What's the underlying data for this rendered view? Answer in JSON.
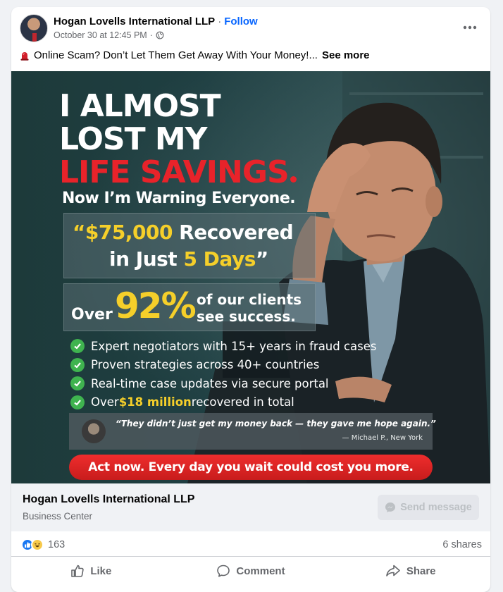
{
  "post": {
    "author": "Hogan Lovells International LLP",
    "separator": "·",
    "follow_label": "Follow",
    "timestamp": "October 30 at 12:45 PM",
    "meta_separator": "·",
    "privacy_icon": "globe-icon",
    "more_icon": "more-options-icon",
    "caption": "Online Scam? Don’t Let Them Get Away With Your Money!...",
    "caption_icon": "siren-icon",
    "see_more": "See more"
  },
  "ad": {
    "headline_l1": "I ALMOST",
    "headline_l2": "LOST MY",
    "headline_l3": "LIFE SAVINGS",
    "subline": "Now I’m Warning Everyone.",
    "box1_amount": "“$75,000",
    "box1_recovered": " Recovered",
    "box1_in": "in Just ",
    "box1_days": "5 Days",
    "box1_close": "”",
    "over": "Over",
    "percent": "92%",
    "pct_line1": "of our clients",
    "pct_line2": "see success.",
    "bullets": [
      "Expert negotiators with 15+ years in fraud cases",
      "Proven strategies across 40+ countries",
      "Real-time case updates via secure portal"
    ],
    "bullet4_pre": "Over ",
    "bullet4_highlight": "$18 million",
    "bullet4_post": " recovered in total",
    "quote": "“They didn’t just get my money back — they gave me hope again.”",
    "quote_author": "— Michael P., New York",
    "cta": "Act now. Every day you wait could cost you more.",
    "colors": {
      "accent_red": "#e8232a",
      "accent_yellow": "#f5cf2a",
      "check_green": "#3fb34f"
    }
  },
  "business": {
    "name": "Hogan Lovells International LLP",
    "category": "Business Center",
    "send_label": "Send message",
    "send_icon": "messenger-icon"
  },
  "engagement": {
    "reaction_count": "163",
    "shares": "6 shares"
  },
  "actions": {
    "like": "Like",
    "comment": "Comment",
    "share": "Share"
  }
}
